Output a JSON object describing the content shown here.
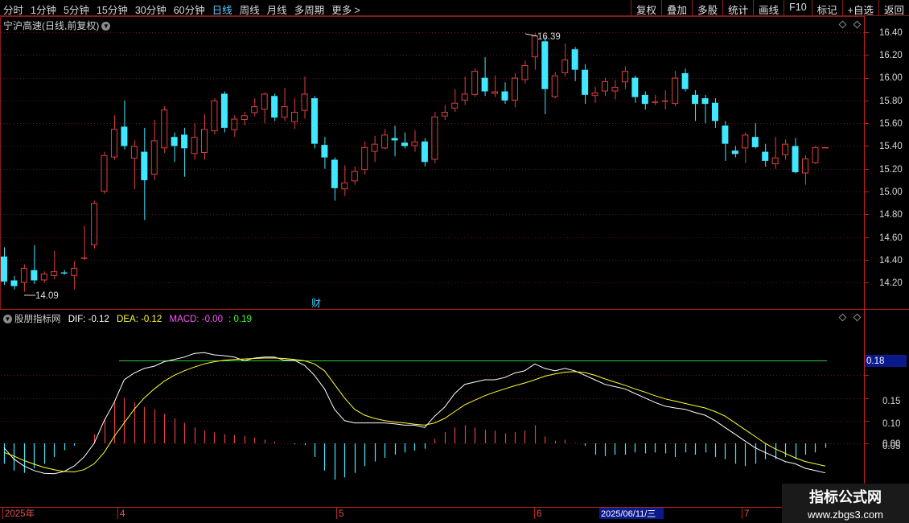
{
  "toolbar": {
    "periods": [
      "分时",
      "1分钟",
      "5分钟",
      "15分钟",
      "30分钟",
      "60分钟",
      "日线",
      "周线",
      "月线",
      "多周期",
      "更多 >"
    ],
    "active_period": "日线",
    "buttons": [
      "复权",
      "叠加",
      "多股",
      "统计",
      "画线",
      "F10",
      "标记",
      "+自选",
      "返回"
    ]
  },
  "main_chart": {
    "title": "宁沪高速(日线,前复权)",
    "high_label": "16.39",
    "low_label": "14.09",
    "finance_marker": "财",
    "y_ticks": [
      "16.40",
      "16.20",
      "16.00",
      "15.80",
      "15.60",
      "15.40",
      "15.20",
      "15.00",
      "14.80",
      "14.60",
      "14.40",
      "14.20"
    ]
  },
  "indicator": {
    "name": "股朋指标网",
    "dif_label": "DIF: -0.12",
    "dea_label": "DEA: -0.12",
    "macd_label": "MACD: -0.00",
    "extra_label": ": 0.19",
    "level_label": "0.18",
    "y_ticks": [
      "0.15",
      "0.10",
      "0.05",
      "0.00"
    ],
    "colors": {
      "dif": "#ffffff",
      "dea": "#ffff33",
      "macd": "#ff55ff",
      "extra": "#33ff33",
      "level_line": "#33cc33",
      "up": "#e04040",
      "down": "#40e8ff"
    }
  },
  "x_axis": {
    "labels": [
      "2025年",
      "4",
      "5",
      "6",
      "2025/06/11/三",
      "7"
    ]
  },
  "watermark": {
    "title": "指标公式网",
    "url": "www.zbgs3.com"
  }
}
